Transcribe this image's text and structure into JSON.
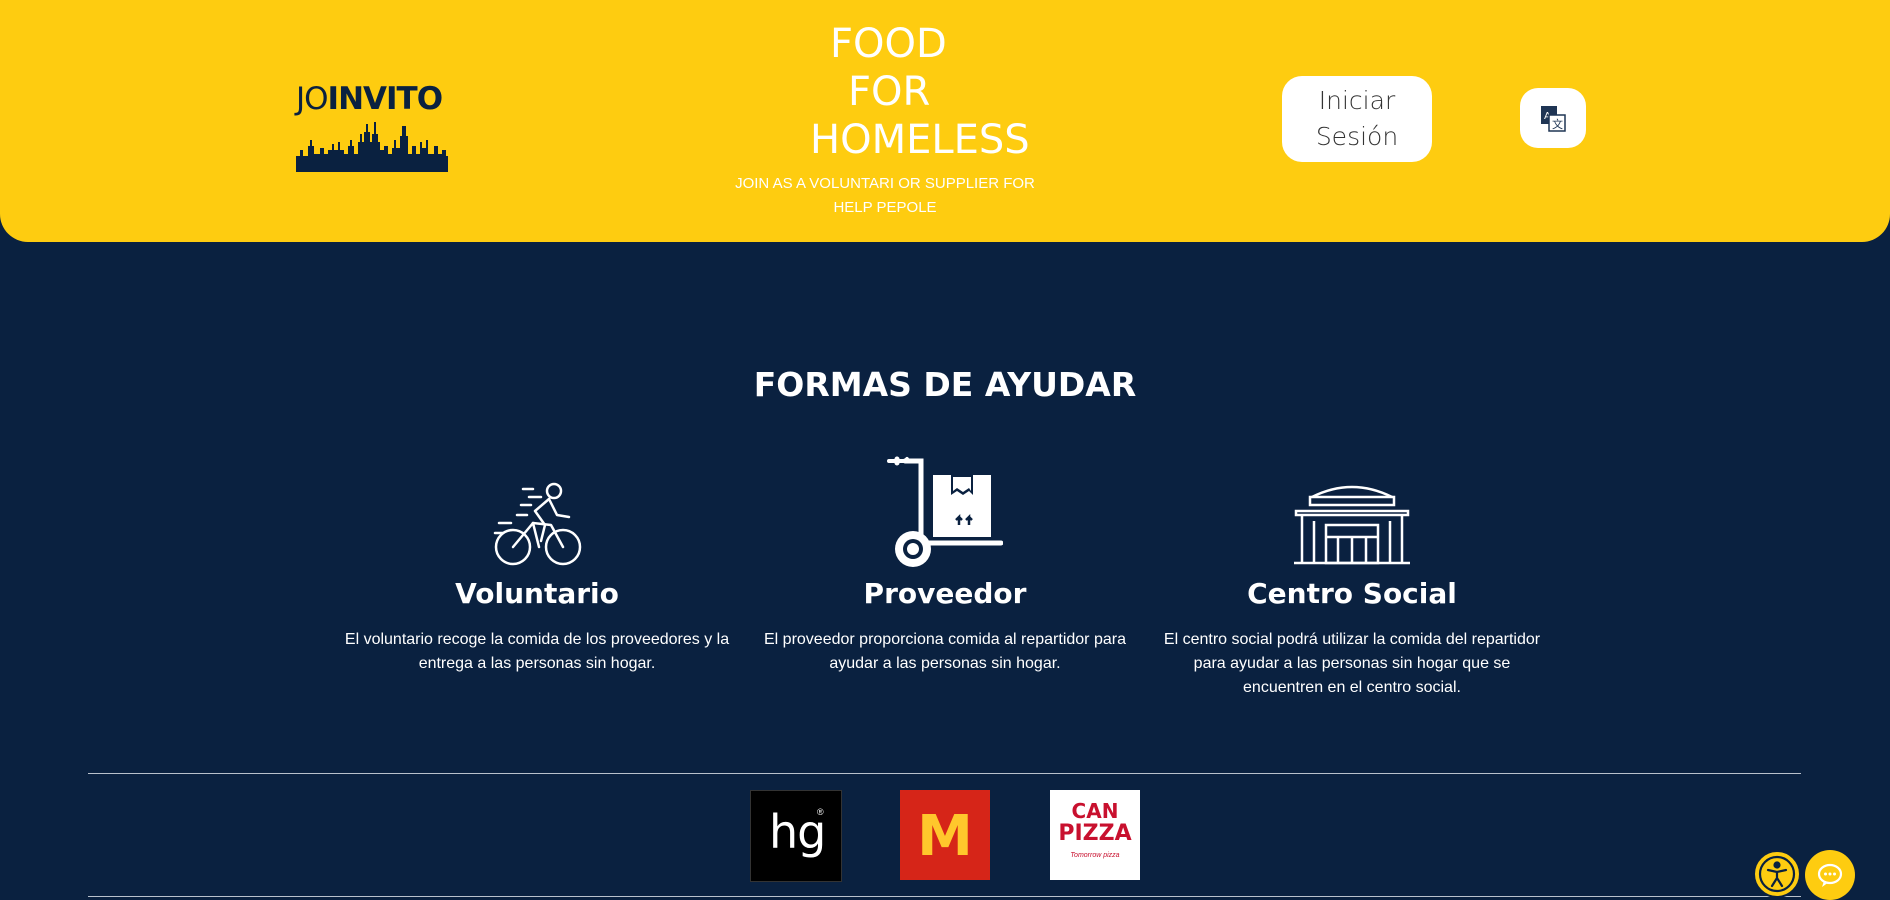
{
  "header": {
    "logo_text_light": "JO",
    "logo_text_bold": "INVITO",
    "title_lines": [
      "FOOD",
      "FOR",
      "HOMELESS"
    ],
    "subtitle": "JOIN AS A VOLUNTARI OR SUPPLIER FOR HELP PEPOLE",
    "login_label": "Iniciar Sesión",
    "translate_icon": "translate-icon"
  },
  "main": {
    "section_title": "FORMAS DE AYUDAR",
    "cards": [
      {
        "icon": "cyclist-icon",
        "title": "Voluntario",
        "text": "El voluntario recoge la comida de los proveedores y la entrega a las personas sin hogar."
      },
      {
        "icon": "hand-truck-icon",
        "title": "Proveedor",
        "text": "El proveedor proporciona comida al repartidor para ayudar a las personas sin hogar."
      },
      {
        "icon": "building-icon",
        "title": "Centro Social",
        "text": "El centro social podrá utilizar la comida del repartidor para ayudar a las personas sin hogar que se encuentren en el centro social."
      }
    ]
  },
  "partners": {
    "hg": "hg",
    "hg_mark": "®",
    "mcdonalds": "M",
    "canpizza_line1": "CAN",
    "canpizza_line2": "PIZZA",
    "canpizza_tag": "Tomorrow pizza"
  },
  "colors": {
    "header_bg": "#fecc10",
    "page_bg": "#0a2140",
    "accent": "#fecc10"
  },
  "floating": {
    "accessibility_icon": "accessibility-icon",
    "chat_icon": "chat-icon"
  }
}
